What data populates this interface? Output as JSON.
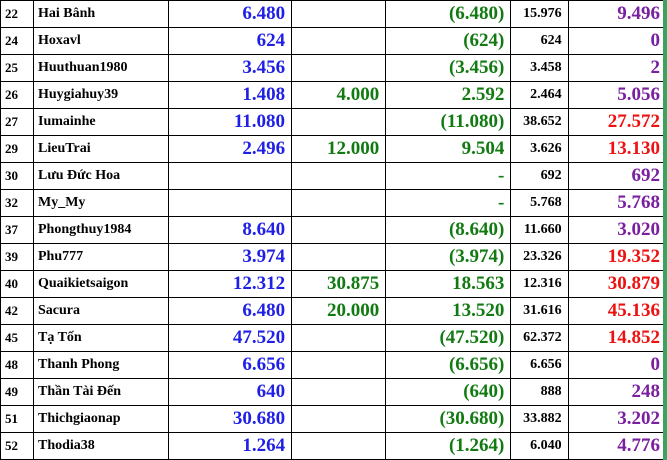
{
  "rows": [
    {
      "no": "22",
      "name": "Hai Bânh",
      "a": "6.480",
      "b": "",
      "c": "(6.480)",
      "d": "15.976",
      "e": "9.496",
      "e_color": "purple"
    },
    {
      "no": "24",
      "name": "Hoxavl",
      "a": "624",
      "b": "",
      "c": "(624)",
      "d": "624",
      "e": "0",
      "e_color": "purple"
    },
    {
      "no": "25",
      "name": "Huuthuan1980",
      "a": "3.456",
      "b": "",
      "c": "(3.456)",
      "d": "3.458",
      "e": "2",
      "e_color": "purple"
    },
    {
      "no": "26",
      "name": "Huygiahuy39",
      "a": "1.408",
      "b": "4.000",
      "c": "2.592",
      "d": "2.464",
      "e": "5.056",
      "e_color": "purple"
    },
    {
      "no": "27",
      "name": "Iumainhe",
      "a": "11.080",
      "b": "",
      "c": "(11.080)",
      "d": "38.652",
      "e": "27.572",
      "e_color": "red"
    },
    {
      "no": "29",
      "name": "LieuTrai",
      "a": "2.496",
      "b": "12.000",
      "c": "9.504",
      "d": "3.626",
      "e": "13.130",
      "e_color": "red"
    },
    {
      "no": "30",
      "name": "Lưu Đức Hoa",
      "a": "",
      "b": "",
      "c": "-",
      "d": "692",
      "e": "692",
      "e_color": "purple"
    },
    {
      "no": "32",
      "name": "My_My",
      "a": "",
      "b": "",
      "c": "-",
      "d": "5.768",
      "e": "5.768",
      "e_color": "purple"
    },
    {
      "no": "37",
      "name": "Phongthuy1984",
      "a": "8.640",
      "b": "",
      "c": "(8.640)",
      "d": "11.660",
      "e": "3.020",
      "e_color": "purple"
    },
    {
      "no": "39",
      "name": "Phu777",
      "a": "3.974",
      "b": "",
      "c": "(3.974)",
      "d": "23.326",
      "e": "19.352",
      "e_color": "red"
    },
    {
      "no": "40",
      "name": "Quaikietsaigon",
      "a": "12.312",
      "b": "30.875",
      "c": "18.563",
      "d": "12.316",
      "e": "30.879",
      "e_color": "red"
    },
    {
      "no": "42",
      "name": "Sacura",
      "a": "6.480",
      "b": "20.000",
      "c": "13.520",
      "d": "31.616",
      "e": "45.136",
      "e_color": "red"
    },
    {
      "no": "45",
      "name": "Tạ Tốn",
      "a": "47.520",
      "b": "",
      "c": "(47.520)",
      "d": "62.372",
      "e": "14.852",
      "e_color": "red"
    },
    {
      "no": "48",
      "name": "Thanh Phong",
      "a": "6.656",
      "b": "",
      "c": "(6.656)",
      "d": "6.656",
      "e": "0",
      "e_color": "purple"
    },
    {
      "no": "49",
      "name": "Thần Tài Đến",
      "a": "640",
      "b": "",
      "c": "(640)",
      "d": "888",
      "e": "248",
      "e_color": "purple"
    },
    {
      "no": "51",
      "name": "Thichgiaonap",
      "a": "30.680",
      "b": "",
      "c": "(30.680)",
      "d": "33.882",
      "e": "3.202",
      "e_color": "purple"
    },
    {
      "no": "52",
      "name": "Thodia38",
      "a": "1.264",
      "b": "",
      "c": "(1.264)",
      "d": "6.040",
      "e": "4.776",
      "e_color": "purple"
    }
  ]
}
